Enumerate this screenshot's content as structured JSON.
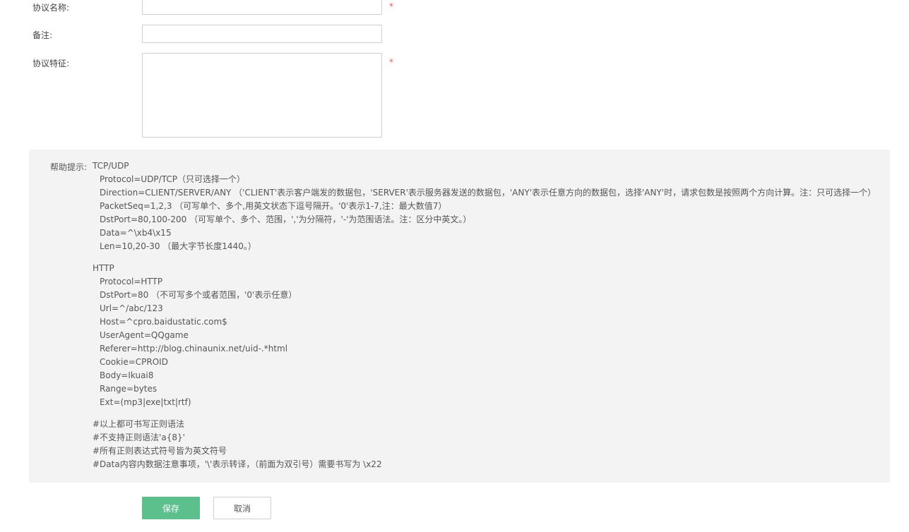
{
  "form": {
    "protocol_name_label": "协议名称:",
    "protocol_name_value": "",
    "remark_label": "备注:",
    "remark_value": "",
    "feature_label": "协议特征:",
    "feature_value": "",
    "required_mark": "*"
  },
  "help": {
    "label": "帮助提示:",
    "tcp_udp": {
      "title": "TCP/UDP",
      "lines": [
        "Protocol=UDP/TCP（只可选择一个）",
        "Direction=CLIENT/SERVER/ANY （'CLIENT'表示客户端发的数据包，'SERVER'表示服务器发送的数据包，'ANY'表示任意方向的数据包，选择'ANY'时，请求包数是按照两个方向计算。注：只可选择一个）",
        "PacketSeq=1,2,3 （可写单个、多个,用英文状态下逗号隔开。'0'表示1-7,注：最大数值7）",
        "DstPort=80,100-200 （可写单个、多个、范围，','为分隔符，'-'为范围语法。注：区分中英文。）",
        "Data=^\\xb4\\x15",
        "Len=10,20-30 （最大字节长度1440。）"
      ]
    },
    "http": {
      "title": "HTTP",
      "lines": [
        "Protocol=HTTP",
        "DstPort=80 （不可写多个或者范围，'0'表示任意）",
        "Url=^/abc/123",
        "Host=^cpro.baidustatic.com$",
        "UserAgent=QQgame",
        "Referer=http://blog.chinaunix.net/uid-.*html",
        "Cookie=CPROID",
        "Body=Ikuai8",
        "Range=bytes",
        "Ext=(mp3|exe|txt|rtf)"
      ]
    },
    "notes": [
      "#以上都可书写正则语法",
      "#不支持正则语法'a{8}'",
      "#所有正则表达式符号皆为英文符号",
      "#Data内容内数据注意事项，'\\'表示转译，（前面为双引号）需要书写为 \\x22"
    ]
  },
  "buttons": {
    "save_label": "保存",
    "cancel_label": "取消"
  },
  "colors": {
    "save_button": "#5cc08d",
    "required_star": "#e8584a",
    "help_background": "#f3f3f3"
  }
}
